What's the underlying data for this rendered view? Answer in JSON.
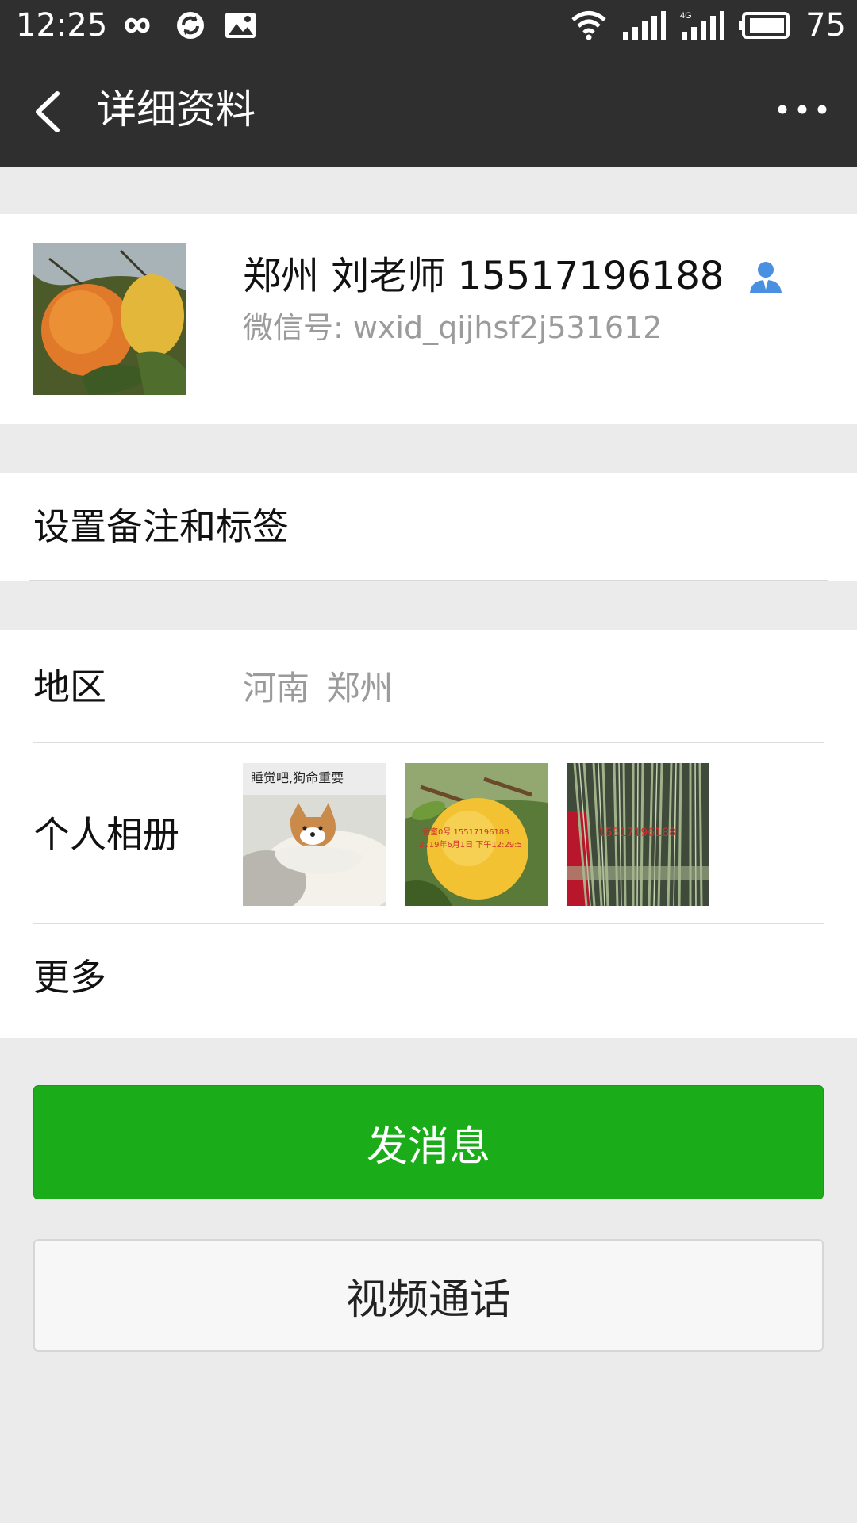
{
  "status_bar": {
    "time": "12:25",
    "battery": "75",
    "icons": [
      "infinity-icon",
      "sync-icon",
      "image-icon",
      "wifi-icon",
      "signal-icon",
      "signal-4g-icon",
      "battery-icon"
    ]
  },
  "header": {
    "title": "详细资料",
    "back_icon": "chevron-left-icon",
    "more_icon": "more-dots-icon"
  },
  "profile": {
    "nickname": "郑州 刘老师 15517196188",
    "wechat_id": "微信号: wxid_qijhsf2j531612",
    "contact_icon": "person-icon"
  },
  "remark": {
    "label": "设置备注和标签"
  },
  "info": {
    "region_label": "地区",
    "region_value": "河南  郑州",
    "album_label": "个人相册",
    "more_label": "更多",
    "album_thumbs": [
      {
        "caption": "睡觉吧,狗命重要"
      },
      {
        "caption_line1": "金蜜0号 15517196188",
        "caption_line2": "2019年6月1日 下午12:29:5"
      },
      {
        "caption": "15517196188"
      }
    ]
  },
  "actions": {
    "send_message": "发消息",
    "video_call": "视频通话"
  },
  "colors": {
    "header_bg": "#2f2f2f",
    "page_bg": "#ebebeb",
    "primary_green": "#1aad19",
    "contact_icon_blue": "#4a90e2"
  }
}
